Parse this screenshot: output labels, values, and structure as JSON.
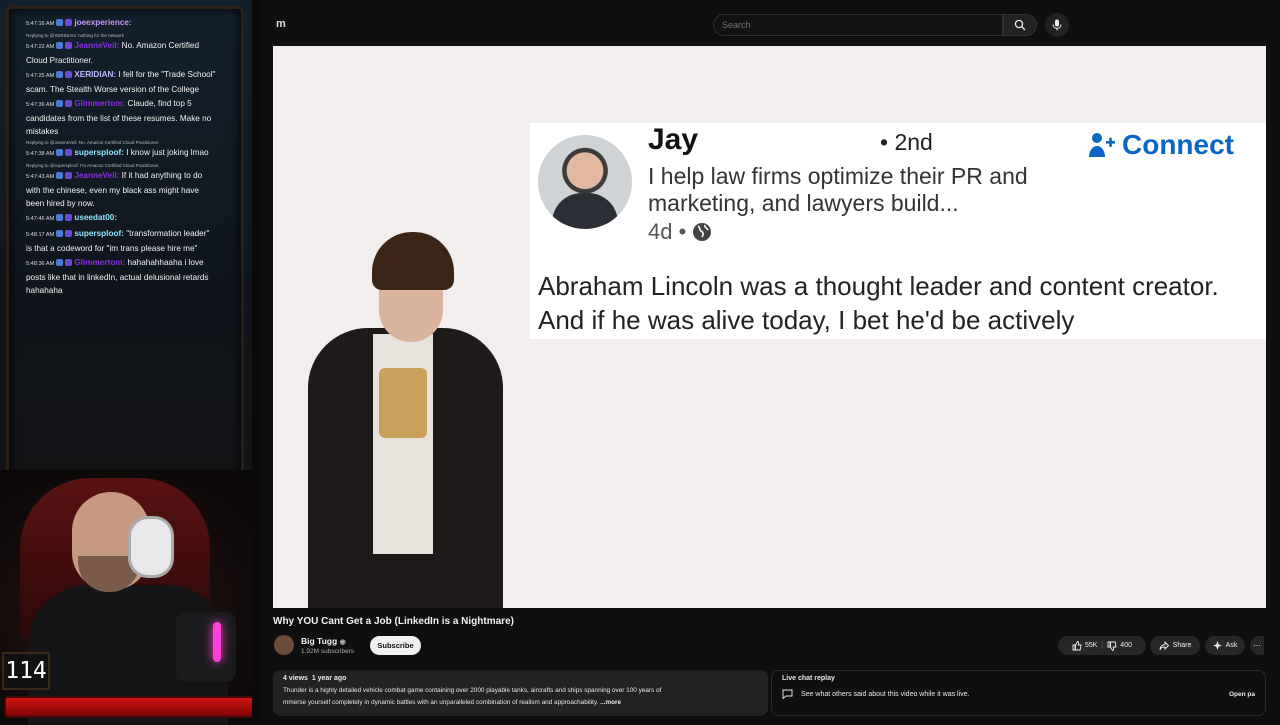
{
  "chat": [
    {
      "time": "5:47:16 AM",
      "user": "joeexperience:",
      "user_color": "#c79aff",
      "text": "",
      "reply": ""
    },
    {
      "time": "5:47:22 AM",
      "user": "JeanneVeil:",
      "user_color": "#8b2be2",
      "text": "No. Amazon Certified Cloud Practitioner.",
      "reply": "Replying to @XERIDIAN: nothing for the network"
    },
    {
      "time": "5:47:25 AM",
      "user": "XERIDIAN:",
      "user_color": "#b9b9ff",
      "text": "I fell for the \"Trade School\" scam. The Stealth Worse version of the College",
      "reply": ""
    },
    {
      "time": "5:47:36 AM",
      "user": "Glimmertom:",
      "user_color": "#8b2be2",
      "text": "Claude, find top 5 candidates from the list of these resumes. Make no mistakes",
      "reply": ""
    },
    {
      "time": "5:47:38 AM",
      "user": "supersploof:",
      "user_color": "#8fe3ff",
      "text": "I know just joking lmao",
      "reply": "Replying to @JeanneVeil: No. Amazon Certified Cloud Practitioner."
    },
    {
      "time": "5:47:43 AM",
      "user": "JeanneVeil:",
      "user_color": "#8b2be2",
      "text": "If it had anything to do with the chinese, even my black ass might have been hired by now.",
      "reply": "Replying to @supersploof: I'm Amazon Certified Cloud Practitioner."
    },
    {
      "time": "5:47:46 AM",
      "user": "useedat00:",
      "user_color": "#8fe3ff",
      "text": "",
      "reply": ""
    },
    {
      "time": "5:48:17 AM",
      "user": "supersploof:",
      "user_color": "#8fe3ff",
      "text": "\"transformation leader\" is that a codeword for \"im trans please hire me\"",
      "reply": ""
    },
    {
      "time": "5:48:36 AM",
      "user": "Glimmertom:",
      "user_color": "#8b2be2",
      "text": "hahahahhaaha i love posts like that in linkedIn, actual delusional retards hahahaha",
      "reply": ""
    }
  ],
  "counter": "114",
  "yt": {
    "logo_fragment": "m",
    "search_placeholder": "Search",
    "video_title": "Why YOU Cant Get a Job (LinkedIn is a Nightmare)",
    "channel_name": "Big Tugg",
    "channel_subs": "1.92M subscribers",
    "subscribe_label": "Subscribe",
    "likes": "55K",
    "dislikes": "400",
    "share_label": "Share",
    "ask_label": "Ask",
    "views": "4 views",
    "age": "1 year ago",
    "desc_line1": "Thunder is a highly detailed vehicle combat game containing over 2000 playable tanks, aircrafts and ships spanning over 100 years of",
    "desc_line2": "mmerse yourself completely in dynamic battles with an unparalleled combination of realism and approachability.",
    "desc_more": "...more",
    "live_title": "Live chat replay",
    "live_text": "See what others said about this video while it was live.",
    "live_open": "Open pa"
  },
  "post": {
    "name": "Jay",
    "degree": "• 2nd",
    "connect_label": "Connect",
    "headline": "I help law firms optimize their PR and marketing, and lawyers build...",
    "age": "4d •",
    "text": "Abraham Lincoln was a thought leader and content creator. And if he was alive today, I bet he'd be actively"
  },
  "colors": {
    "accent_blue": "#0a66c2",
    "live_bar": "#d51515",
    "mic_light": "#ff3fd6"
  }
}
